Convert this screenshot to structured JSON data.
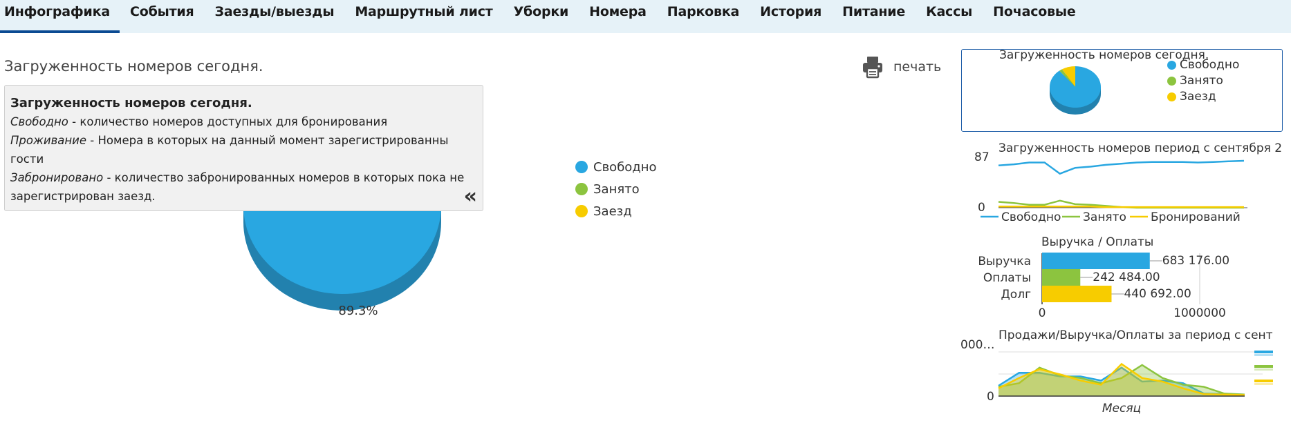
{
  "tabs": [
    {
      "label": "Инфографика",
      "active": true
    },
    {
      "label": "События"
    },
    {
      "label": "Заезды/выезды"
    },
    {
      "label": "Маршрутный лист"
    },
    {
      "label": "Уборки"
    },
    {
      "label": "Номера"
    },
    {
      "label": "Парковка"
    },
    {
      "label": "История"
    },
    {
      "label": "Питание"
    },
    {
      "label": "Кассы"
    },
    {
      "label": "Почасовые"
    }
  ],
  "page_title": "Загруженность номеров сегодня.",
  "print_label": "печать",
  "info": {
    "heading": "Загруженность номеров сегодня.",
    "line1_term": "Свободно",
    "line1_text": " - количество номеров доступных для бронирования",
    "line2_term": "Проживание",
    "line2_text": " - Номера в которых на данный момент зарегистрированны гости",
    "line3_term": "Забронировано",
    "line3_text": " - количество забронированных номеров в которых пока не зарегистрирован заезд.",
    "collapse_icon": "«"
  },
  "colors": {
    "free": "#29a7e1",
    "occupied": "#8cc43f",
    "arrival": "#f7cc00",
    "free_dark": "#2281ae"
  },
  "main_chart": {
    "legend": [
      "Свободно",
      "Занято",
      "Заезд"
    ],
    "slice_label": "89.3%"
  },
  "mini_today": {
    "title": "Загруженность номеров сегодня.",
    "legend": [
      "Свободно",
      "Занято",
      "Заезд"
    ]
  },
  "mini_period": {
    "title": "Загруженность номеров период с сентября 2",
    "y_max_label": "87",
    "y_min_label": "0",
    "legend": [
      "Свободно",
      "Занято",
      "Бронирований"
    ]
  },
  "mini_revenue": {
    "title": "Выручка / Оплаты",
    "x_min_label": "0",
    "x_max_label": "1000000"
  },
  "mini_sales": {
    "title": "Продажи/Выручка/Оплаты за период с сент",
    "y_top_label": "000…",
    "y_zero_label": "0",
    "x_label": "Месяц"
  },
  "chart_data": [
    {
      "type": "pie",
      "title": "",
      "categories": [
        "Свободно",
        "Занято",
        "Заезд"
      ],
      "values": [
        89.3,
        2.0,
        8.7
      ],
      "data_labels": [
        "89.3%"
      ]
    },
    {
      "type": "pie",
      "title": "Загруженность номеров сегодня.",
      "categories": [
        "Свободно",
        "Занято",
        "Заезд"
      ],
      "values": [
        89.3,
        2.0,
        8.7
      ]
    },
    {
      "type": "line",
      "title": "Загруженность номеров период с сентября 2",
      "ylim": [
        0,
        87
      ],
      "x": [
        1,
        2,
        3,
        4,
        5,
        6,
        7,
        8,
        9,
        10,
        11,
        12,
        13,
        14,
        15,
        16,
        17
      ],
      "series": [
        {
          "name": "Свободно",
          "values": [
            72,
            74,
            77,
            77,
            58,
            68,
            70,
            73,
            75,
            77,
            78,
            78,
            78,
            77,
            78,
            79,
            80
          ]
        },
        {
          "name": "Занято",
          "values": [
            10,
            8,
            5,
            5,
            12,
            6,
            5,
            3,
            1,
            0,
            0,
            0,
            0,
            0,
            0,
            0,
            0
          ]
        },
        {
          "name": "Бронирований",
          "values": [
            2,
            2,
            2,
            2,
            2,
            2,
            2,
            1,
            1,
            1,
            1,
            1,
            1,
            1,
            1,
            1,
            1
          ]
        }
      ]
    },
    {
      "type": "bar",
      "orientation": "horizontal",
      "title": "Выручка / Оплаты",
      "categories": [
        "Выручка",
        "Оплаты",
        "Долг"
      ],
      "values": [
        683176,
        242484,
        440692
      ],
      "data_labels": [
        "683 176.00",
        "242 484.00",
        "440 692.00"
      ],
      "xlim": [
        0,
        1000000
      ]
    },
    {
      "type": "area",
      "title": "Продажи/Выручка/Оплаты за период с сент",
      "xlabel": "Месяц",
      "x": [
        1,
        2,
        3,
        4,
        5,
        6,
        7,
        8,
        9,
        10,
        11,
        12,
        13
      ],
      "series": [
        {
          "values": [
            20,
            45,
            45,
            38,
            38,
            30,
            55,
            28,
            30,
            25,
            5,
            4,
            3
          ]
        },
        {
          "values": [
            18,
            25,
            55,
            40,
            35,
            25,
            35,
            60,
            35,
            22,
            18,
            5,
            3
          ]
        },
        {
          "values": [
            15,
            35,
            52,
            42,
            30,
            22,
            62,
            35,
            28,
            15,
            4,
            3,
            2
          ]
        }
      ]
    }
  ]
}
